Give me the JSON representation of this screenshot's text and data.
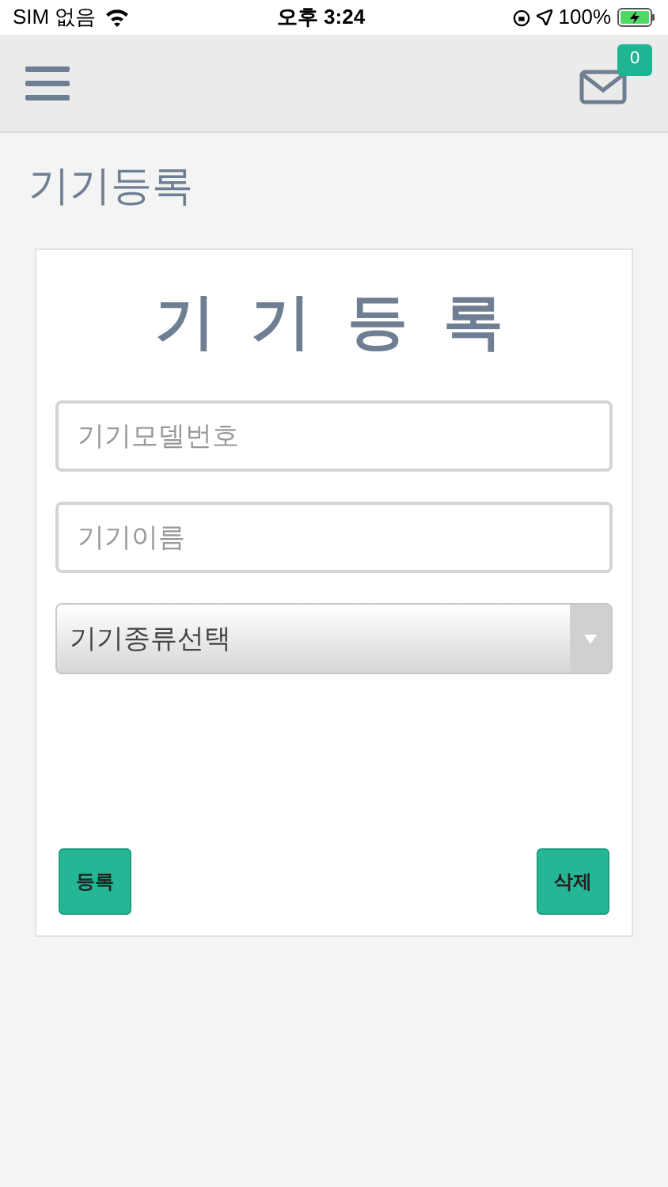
{
  "status_bar": {
    "carrier": "SIM 없음",
    "time": "오후 3:24",
    "battery": "100%"
  },
  "header": {
    "badge": "0"
  },
  "page_title": "기기등록",
  "form": {
    "heading": "기 기 등 록",
    "fields": [
      {
        "placeholder": "기기모델번호"
      },
      {
        "placeholder": "기기이름"
      }
    ],
    "select": {
      "value": "기기종류선택"
    },
    "buttons": [
      "등록",
      "삭제"
    ]
  }
}
